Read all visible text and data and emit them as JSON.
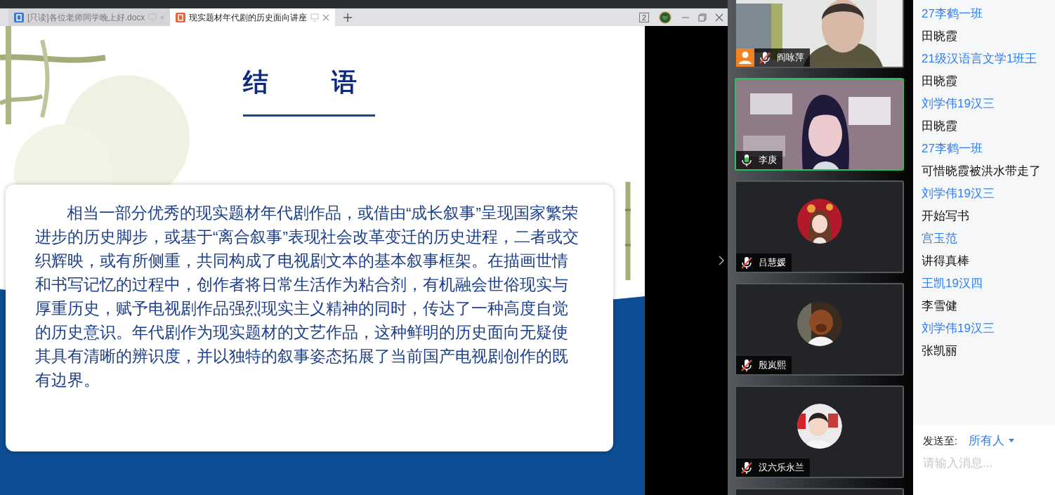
{
  "tabs": [
    {
      "kind": "doc",
      "label": "[只读]各位老师同学晚上好.docx",
      "selected": false
    },
    {
      "kind": "slides",
      "label": "现实题材年代剧的历史面向讲座",
      "selected": true
    }
  ],
  "window_badge": "2",
  "slide": {
    "title": "结 语",
    "paragraph": "相当一部分优秀的现实题材年代剧作品，或借由“成长叙事”呈现国家繁荣进步的历史脚步，或基于“离合叙事”表现社会改革变迁的历史进程，二者或交织辉映，或有所侧重，共同构成了电视剧文本的基本叙事框架。在描画世情和书写记忆的过程中，创作者将日常生活作为粘合剂，有机融会世俗现实与厚重历史，赋予电视剧作品强烈现实主义精神的同时，传达了一种高度自觉的历史意识。年代剧作为现实题材的文艺作品，这种鲜明的历史面向无疑使其具有清晰的辨识度，并以独特的叙事姿态拓展了当前国产电视剧创作的既有边界。"
  },
  "participants": [
    {
      "name": "阎咏萍",
      "kind": "video",
      "host": true,
      "muted": true,
      "speaking": false
    },
    {
      "name": "李庚",
      "kind": "video",
      "host": false,
      "muted": false,
      "speaking": true
    },
    {
      "name": "吕慧媛",
      "kind": "avatar",
      "host": false,
      "muted": true,
      "speaking": false
    },
    {
      "name": "殷岚熙",
      "kind": "avatar",
      "host": false,
      "muted": true,
      "speaking": false
    },
    {
      "name": "汉六乐永兰",
      "kind": "avatar",
      "host": false,
      "muted": true,
      "speaking": false
    }
  ],
  "chat": {
    "messages": [
      {
        "sender": "27李鹤一班",
        "text": "田晓霞"
      },
      {
        "sender": "21级汉语言文学1班王",
        "text": "田晓霞"
      },
      {
        "sender": "刘学伟19汉三",
        "text": "田晓霞"
      },
      {
        "sender": "27李鹤一班",
        "text": "可惜晓霞被洪水带走了"
      },
      {
        "sender": "刘学伟19汉三",
        "text": "开始写书"
      },
      {
        "sender": "宫玉范",
        "text": "讲得真棒"
      },
      {
        "sender": "王凯19汉四",
        "text": "李雪健"
      },
      {
        "sender": "刘学伟19汉三",
        "text": "张凯丽"
      }
    ],
    "send_to_label": "发送至:",
    "recipient": "所有人",
    "placeholder": "请输入消息..."
  }
}
